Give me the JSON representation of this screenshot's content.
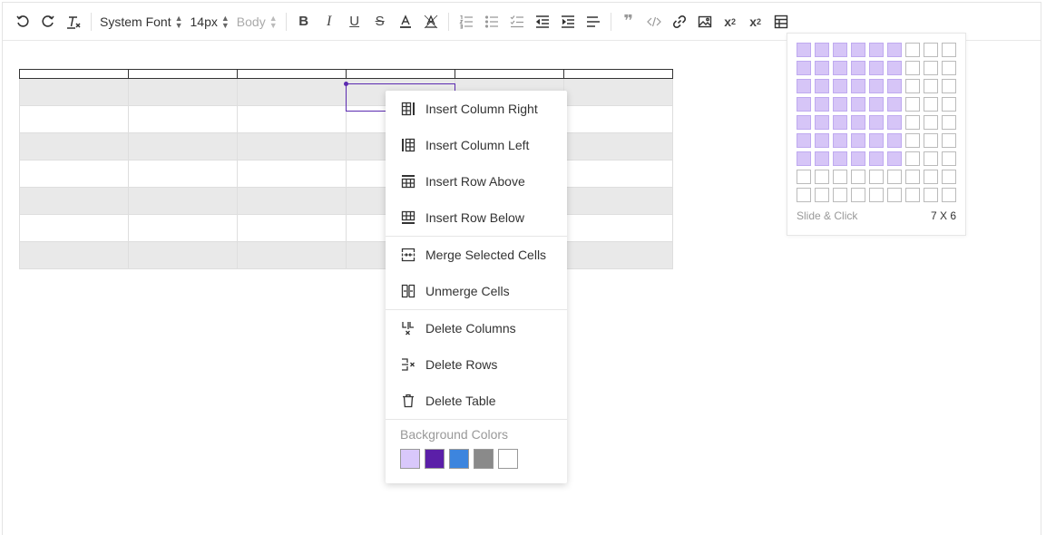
{
  "toolbar": {
    "font_family": "System Font",
    "font_size": "14px",
    "block_type": "Body",
    "icons": [
      "undo-icon",
      "redo-icon",
      "clear-format-icon",
      "bold-icon",
      "italic-icon",
      "underline-icon",
      "strikethrough-icon",
      "font-color-icon",
      "highlight-icon",
      "ordered-list-icon",
      "bullet-list-icon",
      "checklist-icon",
      "outdent-icon",
      "indent-icon",
      "align-icon",
      "quote-icon",
      "code-icon",
      "link-icon",
      "image-icon",
      "subscript-icon",
      "superscript-icon",
      "table-icon"
    ]
  },
  "table": {
    "columns": 6,
    "body_rows": [
      "shaded",
      "white",
      "shaded",
      "white",
      "shaded",
      "white",
      "shaded"
    ]
  },
  "context_menu": {
    "items": [
      {
        "label": "Insert Column Right",
        "icon": "insert-column-right-icon"
      },
      {
        "label": "Insert Column Left",
        "icon": "insert-column-left-icon"
      },
      {
        "label": "Insert Row Above",
        "icon": "insert-row-above-icon"
      },
      {
        "label": "Insert Row Below",
        "icon": "insert-row-below-icon"
      },
      {
        "label": "Merge Selected Cells",
        "icon": "merge-cells-icon"
      },
      {
        "label": "Unmerge Cells",
        "icon": "unmerge-cells-icon"
      },
      {
        "label": "Delete Columns",
        "icon": "delete-columns-icon"
      },
      {
        "label": "Delete Rows",
        "icon": "delete-rows-icon"
      },
      {
        "label": "Delete Table",
        "icon": "delete-table-icon"
      }
    ],
    "background_colors_label": "Background Colors",
    "background_colors": [
      "#d9c8fb",
      "#5b1fa8",
      "#3d85de",
      "#8a8a8a",
      "#ffffff"
    ]
  },
  "table_picker": {
    "hint": "Slide & Click",
    "size_label": "7 X 6",
    "grid_columns": 9,
    "grid_rows": 9,
    "selected_columns": 6,
    "selected_rows": 7,
    "highlight_color": "#d6c5f7"
  }
}
